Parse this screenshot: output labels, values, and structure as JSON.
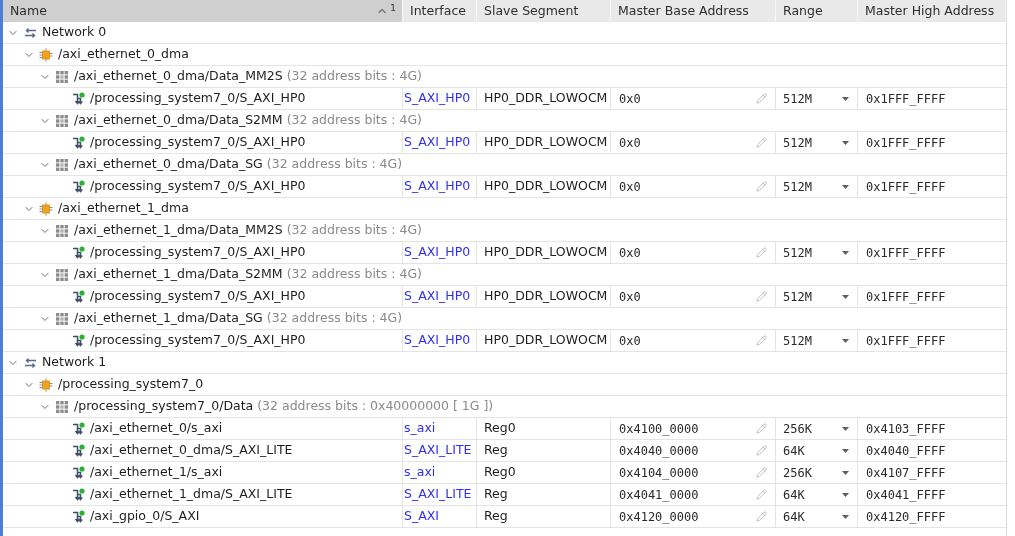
{
  "address_map": {
    "columns": [
      {
        "label": "Name",
        "sorted": true,
        "sort_rank": "1"
      },
      {
        "label": "Interface",
        "sorted": false
      },
      {
        "label": "Slave Segment",
        "sorted": false
      },
      {
        "label": "Master Base Address",
        "sorted": false
      },
      {
        "label": "Range",
        "sorted": false
      },
      {
        "label": "Master High Address",
        "sorted": false
      }
    ],
    "rows": [
      {
        "kind": "network",
        "name": "Network 0",
        "expanded": true,
        "children": [
          {
            "kind": "instance",
            "name": "/axi_ethernet_0_dma",
            "expanded": true,
            "children": [
              {
                "kind": "address_space",
                "name": "/axi_ethernet_0_dma/Data_MM2S",
                "info": "(32 address bits : 4G)",
                "expanded": true,
                "children": [
                  {
                    "kind": "segment",
                    "name": "/processing_system7_0/S_AXI_HP0",
                    "interface": "S_AXI_HP0",
                    "slave_segment": "HP0_DDR_LOWOCM",
                    "base": "0x0",
                    "range": "512M",
                    "high": "0x1FFF_FFFF"
                  }
                ]
              },
              {
                "kind": "address_space",
                "name": "/axi_ethernet_0_dma/Data_S2MM",
                "info": "(32 address bits : 4G)",
                "expanded": true,
                "children": [
                  {
                    "kind": "segment",
                    "name": "/processing_system7_0/S_AXI_HP0",
                    "interface": "S_AXI_HP0",
                    "slave_segment": "HP0_DDR_LOWOCM",
                    "base": "0x0",
                    "range": "512M",
                    "high": "0x1FFF_FFFF"
                  }
                ]
              },
              {
                "kind": "address_space",
                "name": "/axi_ethernet_0_dma/Data_SG",
                "info": "(32 address bits : 4G)",
                "expanded": true,
                "children": [
                  {
                    "kind": "segment",
                    "name": "/processing_system7_0/S_AXI_HP0",
                    "interface": "S_AXI_HP0",
                    "slave_segment": "HP0_DDR_LOWOCM",
                    "base": "0x0",
                    "range": "512M",
                    "high": "0x1FFF_FFFF"
                  }
                ]
              }
            ]
          },
          {
            "kind": "instance",
            "name": "/axi_ethernet_1_dma",
            "expanded": true,
            "children": [
              {
                "kind": "address_space",
                "name": "/axi_ethernet_1_dma/Data_MM2S",
                "info": "(32 address bits : 4G)",
                "expanded": true,
                "children": [
                  {
                    "kind": "segment",
                    "name": "/processing_system7_0/S_AXI_HP0",
                    "interface": "S_AXI_HP0",
                    "slave_segment": "HP0_DDR_LOWOCM",
                    "base": "0x0",
                    "range": "512M",
                    "high": "0x1FFF_FFFF"
                  }
                ]
              },
              {
                "kind": "address_space",
                "name": "/axi_ethernet_1_dma/Data_S2MM",
                "info": "(32 address bits : 4G)",
                "expanded": true,
                "children": [
                  {
                    "kind": "segment",
                    "name": "/processing_system7_0/S_AXI_HP0",
                    "interface": "S_AXI_HP0",
                    "slave_segment": "HP0_DDR_LOWOCM",
                    "base": "0x0",
                    "range": "512M",
                    "high": "0x1FFF_FFFF"
                  }
                ]
              },
              {
                "kind": "address_space",
                "name": "/axi_ethernet_1_dma/Data_SG",
                "info": "(32 address bits : 4G)",
                "expanded": true,
                "children": [
                  {
                    "kind": "segment",
                    "name": "/processing_system7_0/S_AXI_HP0",
                    "interface": "S_AXI_HP0",
                    "slave_segment": "HP0_DDR_LOWOCM",
                    "base": "0x0",
                    "range": "512M",
                    "high": "0x1FFF_FFFF"
                  }
                ]
              }
            ]
          }
        ]
      },
      {
        "kind": "network",
        "name": "Network 1",
        "expanded": true,
        "children": [
          {
            "kind": "instance",
            "name": "/processing_system7_0",
            "expanded": true,
            "children": [
              {
                "kind": "address_space",
                "name": "/processing_system7_0/Data",
                "info": "(32 address bits : 0x40000000 [ 1G ])",
                "expanded": true,
                "children": [
                  {
                    "kind": "segment",
                    "name": "/axi_ethernet_0/s_axi",
                    "interface": "s_axi",
                    "slave_segment": "Reg0",
                    "base": "0x4100_0000",
                    "range": "256K",
                    "high": "0x4103_FFFF"
                  },
                  {
                    "kind": "segment",
                    "name": "/axi_ethernet_0_dma/S_AXI_LITE",
                    "interface": "S_AXI_LITE",
                    "slave_segment": "Reg",
                    "base": "0x4040_0000",
                    "range": "64K",
                    "high": "0x4040_FFFF"
                  },
                  {
                    "kind": "segment",
                    "name": "/axi_ethernet_1/s_axi",
                    "interface": "s_axi",
                    "slave_segment": "Reg0",
                    "base": "0x4104_0000",
                    "range": "256K",
                    "high": "0x4107_FFFF"
                  },
                  {
                    "kind": "segment",
                    "name": "/axi_ethernet_1_dma/S_AXI_LITE",
                    "interface": "S_AXI_LITE",
                    "slave_segment": "Reg",
                    "base": "0x4041_0000",
                    "range": "64K",
                    "high": "0x4041_FFFF"
                  },
                  {
                    "kind": "segment",
                    "name": "/axi_gpio_0/S_AXI",
                    "interface": "S_AXI",
                    "slave_segment": "Reg",
                    "base": "0x4120_0000",
                    "range": "64K",
                    "high": "0x4120_FFFF"
                  }
                ]
              }
            ]
          }
        ]
      }
    ]
  }
}
